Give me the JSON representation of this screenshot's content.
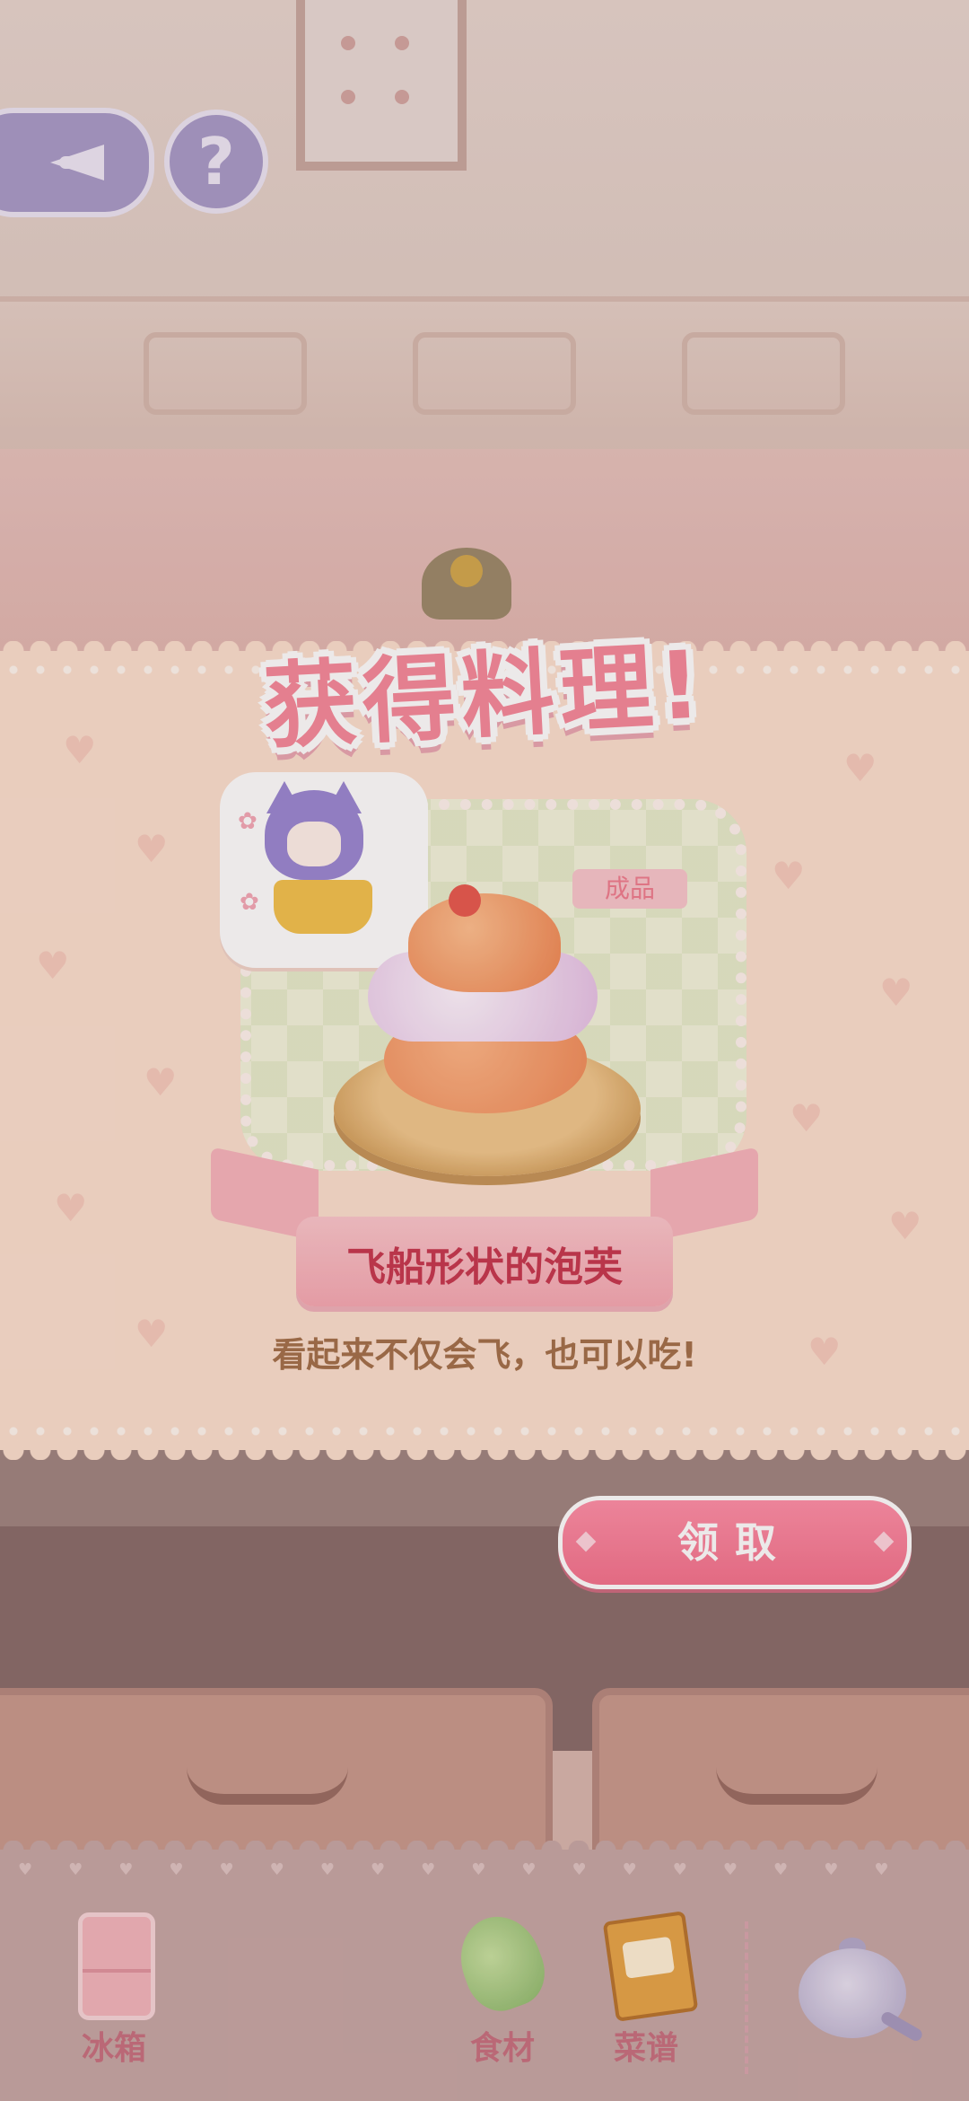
{
  "header": {
    "back_icon": "compass-arrow-icon",
    "help_label": "?"
  },
  "result": {
    "title": "获得料理!",
    "badge": "成品",
    "dish_name": "飞船形状的泡芙",
    "description": "看起来不仅会飞，也可以吃!",
    "claim_label": "领取"
  },
  "bottom_nav": {
    "fridge": "冰箱",
    "ingredients": "食材",
    "recipes": "菜谱",
    "pot_icon": "cooking-pot-icon"
  },
  "colors": {
    "accent_pink": "#f4728d",
    "title_pink": "#f68a9b",
    "panel_bg": "#fce0cf",
    "dish_name_red": "#c7374e",
    "desc_brown": "#a3704a",
    "nav_label": "#c8707f"
  }
}
